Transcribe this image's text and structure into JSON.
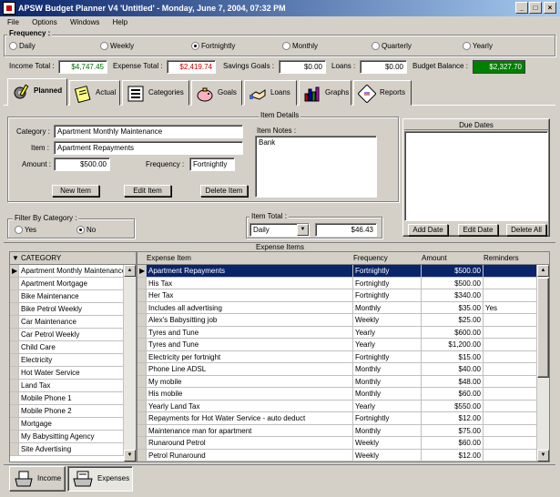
{
  "window": {
    "title": "APSW Budget Planner V4 'Untitled' - Monday, June 7, 2004, 07:32 PM",
    "minimize": "_",
    "maximize": "□",
    "close": "×"
  },
  "menu": [
    "File",
    "Options",
    "Windows",
    "Help"
  ],
  "frequency": {
    "label": "Frequency :",
    "options": [
      "Daily",
      "Weekly",
      "Fortnightly",
      "Monthly",
      "Quarterly",
      "Yearly"
    ],
    "selected": "Fortnightly"
  },
  "totals": {
    "income_label": "Income Total :",
    "income_value": "$4,747.45",
    "expense_label": "Expense Total :",
    "expense_value": "$2,419.74",
    "savings_label": "Savings Goals :",
    "savings_value": "$0.00",
    "loans_label": "Loans :",
    "loans_value": "$0.00",
    "balance_label": "Budget Balance :",
    "balance_value": "$2,327.70",
    "income_color": "#006600",
    "expense_color": "#cc0000",
    "balance_bg": "#008000"
  },
  "tabs": [
    {
      "label": "Planned",
      "icon": "gear-pencil-icon"
    },
    {
      "label": "Actual",
      "icon": "notepad-icon"
    },
    {
      "label": "Categories",
      "icon": "list-icon"
    },
    {
      "label": "Goals",
      "icon": "piggy-bank-icon"
    },
    {
      "label": "Loans",
      "icon": "handshake-icon"
    },
    {
      "label": "Graphs",
      "icon": "bar-chart-icon"
    },
    {
      "label": "Reports",
      "icon": "report-icon"
    }
  ],
  "item_details": {
    "title": "Item Details",
    "category_label": "Category :",
    "category_value": "Apartment Monthly Maintenance",
    "item_label": "Item :",
    "item_value": "Apartment Repayments",
    "amount_label": "Amount :",
    "amount_value": "$500.00",
    "frequency_label": "Frequency :",
    "frequency_value": "Fortnightly",
    "notes_label": "Item Notes :",
    "notes_value": "Bank",
    "new_item": "New Item",
    "edit_item": "Edit Item",
    "delete_item": "Delete Item"
  },
  "due_dates": {
    "title": "Due Dates",
    "add": "Add Date",
    "edit": "Edit Date",
    "delete_all": "Delete All"
  },
  "filter": {
    "label": "Filter By Category :",
    "yes": "Yes",
    "no": "No",
    "selected": "No"
  },
  "item_total": {
    "label": "Item Total :",
    "period": "Daily",
    "value": "$46.43"
  },
  "expense_items_title": "Expense Items",
  "categories": {
    "header": "CATEGORY",
    "rows": [
      "Apartment Monthly Maintenance",
      "Apartment Mortgage",
      "Bike Maintenance",
      "Bike Petrol Weekly",
      "Car Maintenance",
      "Car Petrol Weekly",
      "Child Care",
      "Electricity",
      "Hot Water Service",
      "Land Tax",
      "Mobile Phone 1",
      "Mobile Phone 2",
      "Mortgage",
      "My Babysitting Agency",
      "Site Advertising"
    ]
  },
  "expenses": {
    "headers": [
      "Expense Item",
      "Frequency",
      "Amount",
      "Reminders"
    ],
    "rows": [
      [
        "Apartment Repayments",
        "Fortnightly",
        "$500.00",
        ""
      ],
      [
        "His Tax",
        "Fortnightly",
        "$500.00",
        ""
      ],
      [
        "Her Tax",
        "Fortnightly",
        "$340.00",
        ""
      ],
      [
        "Includes all advertising",
        "Monthly",
        "$35.00",
        "Yes"
      ],
      [
        "Alex's Babysitting job",
        "Weekly",
        "$25.00",
        ""
      ],
      [
        "Tyres and Tune",
        "Yearly",
        "$600.00",
        ""
      ],
      [
        "Tyres and Tune",
        "Yearly",
        "$1,200.00",
        ""
      ],
      [
        "Electricity per fortnight",
        "Fortnightly",
        "$15.00",
        ""
      ],
      [
        "Phone Line ADSL",
        "Monthly",
        "$40.00",
        ""
      ],
      [
        "My mobile",
        "Monthly",
        "$48.00",
        ""
      ],
      [
        "His mobile",
        "Monthly",
        "$60.00",
        ""
      ],
      [
        "Yearly Land Tax",
        "Yearly",
        "$550.00",
        ""
      ],
      [
        "Repayments for Hot Water Service - auto deduct",
        "Fortnightly",
        "$12.00",
        ""
      ],
      [
        "Maintenance man for apartment",
        "Monthly",
        "$75.00",
        ""
      ],
      [
        "Runaround Petrol",
        "Weekly",
        "$60.00",
        ""
      ],
      [
        "Petrol Runaround",
        "Weekly",
        "$12.00",
        ""
      ]
    ]
  },
  "bottom_tabs": [
    {
      "label": "Income",
      "icon": "inbox-tray-icon"
    },
    {
      "label": "Expenses",
      "icon": "outbox-tray-icon"
    }
  ]
}
